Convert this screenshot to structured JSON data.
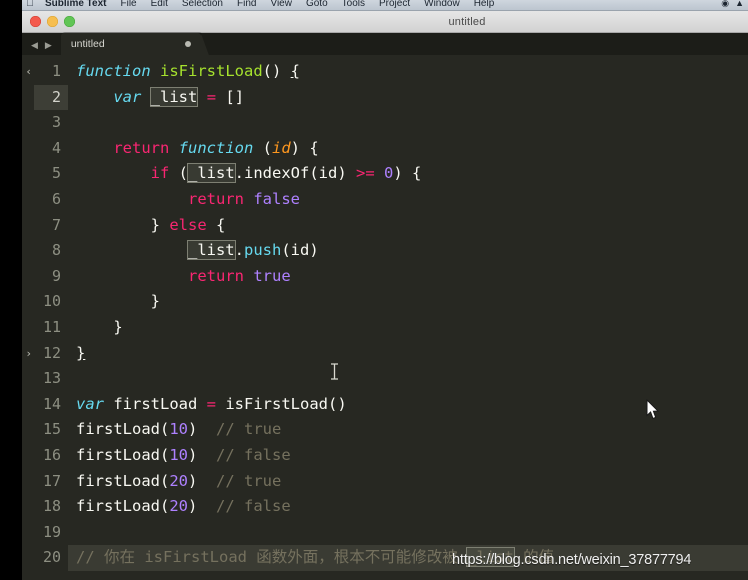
{
  "menubar": {
    "apple_icon": "apple-icon",
    "app_name": "Sublime Text",
    "items": [
      "File",
      "Edit",
      "Selection",
      "Find",
      "View",
      "Goto",
      "Tools",
      "Project",
      "Window",
      "Help"
    ],
    "status_icons": [
      "record-icon",
      "wifi-icon"
    ]
  },
  "window": {
    "title": "untitled",
    "traffic_lights": {
      "close": "close-button",
      "minimize": "minimize-button",
      "maximize": "maximize-button"
    }
  },
  "tabbar": {
    "prev_label": "◀",
    "next_label": "▶",
    "tabs": [
      {
        "label": "untitled",
        "dirty": true
      }
    ]
  },
  "editor": {
    "highlighted_line": 2,
    "current_line": 20,
    "fold_markers": {
      "1": "‹",
      "12": "›"
    },
    "lines": [
      {
        "n": 1,
        "tokens": [
          {
            "t": "function",
            "c": "kw"
          },
          {
            "t": " ",
            "c": "pl"
          },
          {
            "t": "isFirstLoad",
            "c": "fn"
          },
          {
            "t": "() ",
            "c": "pl"
          },
          {
            "t": "{",
            "c": "match"
          }
        ]
      },
      {
        "n": 2,
        "tokens": [
          {
            "t": "    ",
            "c": "pl"
          },
          {
            "t": "var",
            "c": "kw"
          },
          {
            "t": " ",
            "c": "pl"
          },
          {
            "t": "_list",
            "c": "occ"
          },
          {
            "t": " ",
            "c": "pl"
          },
          {
            "t": "=",
            "c": "op"
          },
          {
            "t": " []",
            "c": "pl"
          }
        ]
      },
      {
        "n": 3,
        "tokens": []
      },
      {
        "n": 4,
        "tokens": [
          {
            "t": "    ",
            "c": "pl"
          },
          {
            "t": "return",
            "c": "ret"
          },
          {
            "t": " ",
            "c": "pl"
          },
          {
            "t": "function",
            "c": "kw"
          },
          {
            "t": " (",
            "c": "pl"
          },
          {
            "t": "id",
            "c": "param"
          },
          {
            "t": ") {",
            "c": "pl"
          }
        ]
      },
      {
        "n": 5,
        "tokens": [
          {
            "t": "        ",
            "c": "pl"
          },
          {
            "t": "if",
            "c": "ret"
          },
          {
            "t": " (",
            "c": "pl"
          },
          {
            "t": "_list",
            "c": "occ"
          },
          {
            "t": ".indexOf(",
            "c": "pl"
          },
          {
            "t": "id",
            "c": "pl"
          },
          {
            "t": ") ",
            "c": "pl"
          },
          {
            "t": ">=",
            "c": "op"
          },
          {
            "t": " ",
            "c": "pl"
          },
          {
            "t": "0",
            "c": "lit"
          },
          {
            "t": ") {",
            "c": "pl"
          }
        ]
      },
      {
        "n": 6,
        "tokens": [
          {
            "t": "            ",
            "c": "pl"
          },
          {
            "t": "return",
            "c": "ret"
          },
          {
            "t": " ",
            "c": "pl"
          },
          {
            "t": "false",
            "c": "lit"
          }
        ]
      },
      {
        "n": 7,
        "tokens": [
          {
            "t": "        } ",
            "c": "pl"
          },
          {
            "t": "else",
            "c": "ret"
          },
          {
            "t": " {",
            "c": "pl"
          }
        ]
      },
      {
        "n": 8,
        "tokens": [
          {
            "t": "            ",
            "c": "pl"
          },
          {
            "t": "_list",
            "c": "occ"
          },
          {
            "t": ".",
            "c": "pl"
          },
          {
            "t": "push",
            "c": "meth"
          },
          {
            "t": "(id)",
            "c": "pl"
          }
        ]
      },
      {
        "n": 9,
        "tokens": [
          {
            "t": "            ",
            "c": "pl"
          },
          {
            "t": "return",
            "c": "ret"
          },
          {
            "t": " ",
            "c": "pl"
          },
          {
            "t": "true",
            "c": "lit"
          }
        ]
      },
      {
        "n": 10,
        "tokens": [
          {
            "t": "        }",
            "c": "pl"
          }
        ]
      },
      {
        "n": 11,
        "tokens": [
          {
            "t": "    }",
            "c": "pl"
          }
        ]
      },
      {
        "n": 12,
        "tokens": [
          {
            "t": "}",
            "c": "match"
          }
        ]
      },
      {
        "n": 13,
        "tokens": []
      },
      {
        "n": 14,
        "tokens": [
          {
            "t": "var",
            "c": "kw"
          },
          {
            "t": " firstLoad ",
            "c": "pl"
          },
          {
            "t": "=",
            "c": "op"
          },
          {
            "t": " ",
            "c": "pl"
          },
          {
            "t": "isFirstLoad",
            "c": "pl"
          },
          {
            "t": "()",
            "c": "pl"
          }
        ]
      },
      {
        "n": 15,
        "tokens": [
          {
            "t": "firstLoad(",
            "c": "pl"
          },
          {
            "t": "10",
            "c": "lit"
          },
          {
            "t": ")  ",
            "c": "pl"
          },
          {
            "t": "// true",
            "c": "cmt"
          }
        ]
      },
      {
        "n": 16,
        "tokens": [
          {
            "t": "firstLoad(",
            "c": "pl"
          },
          {
            "t": "10",
            "c": "lit"
          },
          {
            "t": ")  ",
            "c": "pl"
          },
          {
            "t": "// false",
            "c": "cmt"
          }
        ]
      },
      {
        "n": 17,
        "tokens": [
          {
            "t": "firstLoad(",
            "c": "pl"
          },
          {
            "t": "20",
            "c": "lit"
          },
          {
            "t": ")  ",
            "c": "pl"
          },
          {
            "t": "// true",
            "c": "cmt"
          }
        ]
      },
      {
        "n": 18,
        "tokens": [
          {
            "t": "firstLoad(",
            "c": "pl"
          },
          {
            "t": "20",
            "c": "lit"
          },
          {
            "t": ")  ",
            "c": "pl"
          },
          {
            "t": "// false",
            "c": "cmt"
          }
        ]
      },
      {
        "n": 19,
        "tokens": []
      },
      {
        "n": 20,
        "tokens": [
          {
            "t": "// 你在 isFirstLoad 函数外面，根本不可能修改被 ",
            "c": "cmt"
          },
          {
            "t": "_list",
            "c": "occ cmt"
          },
          {
            "t": " 的值",
            "c": "cmt"
          }
        ]
      }
    ]
  },
  "overlay": {
    "watermark": "https://blog.csdn.net/weixin_37877794",
    "text_caret": "i-beam-cursor",
    "mouse_pointer": "mouse-pointer"
  },
  "colors": {
    "background": "#272822",
    "keyword": "#66d9ef",
    "function_name": "#a6e22e",
    "operator": "#f92672",
    "literal": "#ae81ff",
    "parameter": "#fd971f",
    "comment": "#75715e",
    "foreground": "#f8f8f2"
  }
}
